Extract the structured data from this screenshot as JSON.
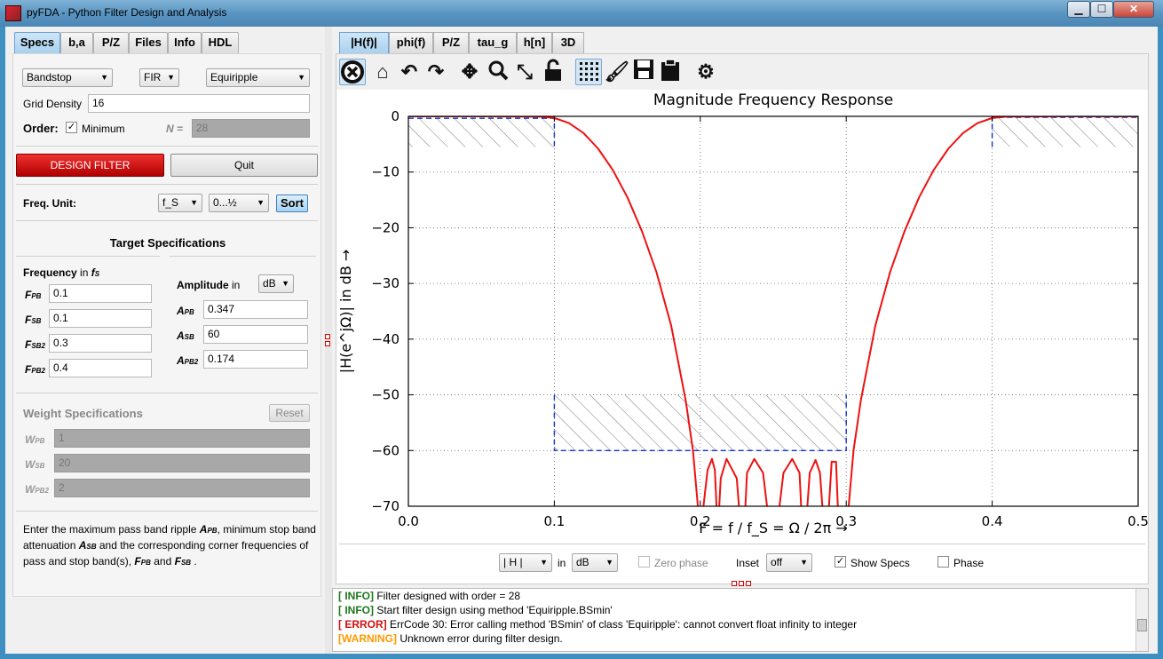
{
  "window": {
    "title": "pyFDA - Python Filter Design and Analysis"
  },
  "left_tabs": [
    "Specs",
    "b,a",
    "P/Z",
    "Files",
    "Info",
    "HDL"
  ],
  "filter_type": {
    "response": "Bandstop",
    "class": "FIR",
    "method": "Equiripple"
  },
  "grid_density": {
    "label": "Grid Density",
    "value": "16"
  },
  "order": {
    "label": "Order:",
    "minimum_label": "Minimum",
    "minimum_checked": true,
    "n_label": "N =",
    "n_value": "28"
  },
  "buttons": {
    "design": "DESIGN FILTER",
    "quit": "Quit"
  },
  "freq_unit": {
    "label": "Freq. Unit:",
    "unit": "f_S",
    "range": "0...½",
    "sort": "Sort"
  },
  "target_specs": {
    "title": "Target Specifications",
    "frequency_label": "Frequency",
    "frequency_in": "in",
    "frequency_unit": "f",
    "frequency_unit_sub": "S",
    "freq_rows": [
      {
        "label": "F",
        "sub": "PB",
        "value": "0.1"
      },
      {
        "label": "F",
        "sub": "SB",
        "value": "0.1"
      },
      {
        "label": "F",
        "sub": "SB2",
        "value": "0.3"
      },
      {
        "label": "F",
        "sub": "PB2",
        "value": "0.4"
      }
    ],
    "amplitude_label": "Amplitude",
    "amplitude_in": "in",
    "amplitude_unit": "dB",
    "amp_rows": [
      {
        "label": "A",
        "sub": "PB",
        "value": "0.347"
      },
      {
        "label": "A",
        "sub": "SB",
        "value": "60"
      },
      {
        "label": "A",
        "sub": "PB2",
        "value": "0.174"
      }
    ]
  },
  "weight_specs": {
    "title": "Weight Specifications",
    "reset": "Reset",
    "rows": [
      {
        "label": "W",
        "sub": "PB",
        "value": "1"
      },
      {
        "label": "W",
        "sub": "SB",
        "value": "20"
      },
      {
        "label": "W",
        "sub": "PB2",
        "value": "2"
      }
    ]
  },
  "help": {
    "t1": "Enter the maximum pass band ripple ",
    "a_pb": "A",
    "a_pb_sub": "PB",
    "t2": ", minimum stop band attenuation ",
    "a_sb": "A",
    "a_sb_sub": "SB",
    "t3": " and the corresponding corner frequencies of pass and stop band(s), ",
    "f_pb": "F",
    "f_pb_sub": "PB",
    "t4": " and ",
    "f_sb": "F",
    "f_sb_sub": "SB",
    "t5": " ."
  },
  "right_tabs": [
    "|H(f)|",
    "phi(f)",
    "P/Z",
    "tau_g",
    "h[n]",
    "3D"
  ],
  "toolbar_icons": [
    "close-circle-icon",
    "home-icon",
    "undo-icon",
    "redo-icon",
    "pan-icon",
    "zoom-icon",
    "fit-view-icon",
    "lock-icon",
    "grid-icon",
    "brush-icon",
    "save-icon",
    "clipboard-icon",
    "settings-icon"
  ],
  "plot_controls": {
    "mag": "| H |",
    "in_label": "in",
    "unit": "dB",
    "zero_phase": "Zero phase",
    "zero_phase_checked": false,
    "inset_label": "Inset",
    "inset": "off",
    "show_specs": "Show Specs",
    "show_specs_checked": true,
    "phase": "Phase",
    "phase_checked": false
  },
  "log": [
    {
      "tag": "[ INFO]",
      "kind": "info",
      "text": " Filter designed with order = 28"
    },
    {
      "tag": "[ INFO]",
      "kind": "info",
      "text": " Start filter design using method 'Equiripple.BSmin'"
    },
    {
      "tag": "[ ERROR]",
      "kind": "err",
      "text": " ErrCode 30: Error calling method 'BSmin' of class 'Equiripple': cannot convert float infinity to integer"
    },
    {
      "tag": "[WARNING]",
      "kind": "warn",
      "text": " Unknown error during filter design."
    }
  ],
  "chart_data": {
    "type": "line",
    "title": "Magnitude Frequency Response",
    "xlabel": "F = f / f_S = Ω / 2π →",
    "ylabel": "|H(e^jΩ)| in dB →",
    "xlim": [
      0.0,
      0.5
    ],
    "ylim": [
      -70,
      0
    ],
    "xticks": [
      "0.0",
      "0.1",
      "0.2",
      "0.3",
      "0.4",
      "0.5"
    ],
    "yticks": [
      "0",
      "−10",
      "−20",
      "−30",
      "−40",
      "−50",
      "−60",
      "−70"
    ],
    "grid": true,
    "series": [
      {
        "color": "#ee1111",
        "x": [
          0.0,
          0.05,
          0.09,
          0.1,
          0.11,
          0.12,
          0.13,
          0.14,
          0.15,
          0.16,
          0.17,
          0.18,
          0.19,
          0.195,
          0.2,
          0.205,
          0.208,
          0.21,
          0.212,
          0.214,
          0.218,
          0.225,
          0.228,
          0.23,
          0.232,
          0.237,
          0.243,
          0.248,
          0.25,
          0.252,
          0.257,
          0.263,
          0.268,
          0.27,
          0.272,
          0.275,
          0.279,
          0.282,
          0.285,
          0.287,
          0.29,
          0.293,
          0.295,
          0.3,
          0.305,
          0.31,
          0.32,
          0.33,
          0.34,
          0.35,
          0.36,
          0.37,
          0.38,
          0.39,
          0.4,
          0.41,
          0.45,
          0.5
        ],
        "y": [
          0.0,
          0.0,
          -0.05,
          -0.3,
          -1.2,
          -3,
          -5.8,
          -9.6,
          -14.5,
          -20.6,
          -28,
          -37.5,
          -51,
          -60,
          -75,
          -63.5,
          -61.5,
          -63.5,
          -75,
          -65,
          -61.5,
          -65,
          -75,
          -75,
          -64,
          -61.5,
          -64,
          -75,
          -75,
          -75,
          -64,
          -61.5,
          -64,
          -75,
          -75,
          -64,
          -61.7,
          -64,
          -75,
          -75,
          -62,
          -62,
          -75,
          -75,
          -60,
          -51,
          -37.5,
          -28,
          -20.6,
          -14.5,
          -9.6,
          -5.8,
          -3,
          -1.2,
          -0.3,
          -0.05,
          0.0,
          0.0
        ]
      }
    ],
    "spec_limits": {
      "color": "#1133cc",
      "pass_band_1": {
        "x": [
          0.0,
          0.1
        ],
        "upper_db": 0,
        "lower_db": -0.347
      },
      "stop_band": {
        "x": [
          0.1,
          0.3
        ],
        "upper_db": -60
      },
      "pass_band_2": {
        "x": [
          0.4,
          0.5
        ],
        "upper_db": 0,
        "lower_db": -0.174
      }
    }
  }
}
